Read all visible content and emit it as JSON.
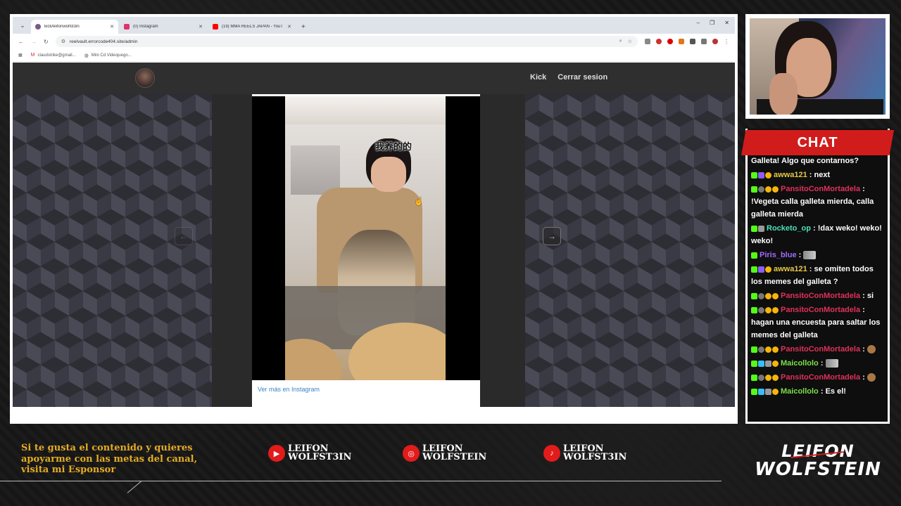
{
  "browser": {
    "tabs": [
      {
        "title": "kick/leifonwolfst3in",
        "active": true,
        "favicon_color": "#7a5a8c"
      },
      {
        "title": "(0) Instagram",
        "active": false,
        "favicon_color": "#e1306c"
      },
      {
        "title": "(19) MMA REELS JAPAN - YouT",
        "active": false,
        "favicon_color": "#ff0000"
      }
    ],
    "url": "reelvault.errorcode404.site/admin",
    "bookmarks": [
      {
        "label": "claudstrike@gmail...",
        "icon": "gmail-icon"
      },
      {
        "label": "Mini Cd Videojuego...",
        "icon": "globe-icon"
      }
    ]
  },
  "site": {
    "nav_links": [
      "Kick",
      "Cerrar sesion"
    ],
    "video_caption": "我养的的",
    "ig_link": "Ver más en Instagram"
  },
  "chat": {
    "title": "CHAT",
    "messages": [
      {
        "user": "",
        "user_color": "#ffffff",
        "badges": [],
        "text": "Galleta! Algo que contarnos?"
      },
      {
        "user": "awwa121",
        "user_color": "#e8c84a",
        "badges": [
          "k",
          "p",
          "o"
        ],
        "text": ": next"
      },
      {
        "user": "PansitoConMortadela",
        "user_color": "#e0305a",
        "badges": [
          "k",
          "g",
          "o",
          "o"
        ],
        "text": ": !Vegeta calla galleta mierda, calla galleta mierda"
      },
      {
        "user": "Rocketo_op",
        "user_color": "#4fe0b8",
        "badges": [
          "k",
          "s"
        ],
        "text": ": !dax weko! weko! weko!"
      },
      {
        "user": "Piris_blue",
        "user_color": "#a06bff",
        "badges": [
          "k"
        ],
        "text": ":",
        "emote": "emote"
      },
      {
        "user": "awwa121",
        "user_color": "#e8c84a",
        "badges": [
          "k",
          "p",
          "o"
        ],
        "text": ": se omiten todos los memes del galleta ?"
      },
      {
        "user": "PansitoConMortadela",
        "user_color": "#e0305a",
        "badges": [
          "k",
          "g",
          "o",
          "o"
        ],
        "text": ": si"
      },
      {
        "user": "PansitoConMortadela",
        "user_color": "#e0305a",
        "badges": [
          "k",
          "g",
          "o",
          "o"
        ],
        "text": ": hagan una encuesta para saltar los memes del galleta"
      },
      {
        "user": "PansitoConMortadela",
        "user_color": "#e0305a",
        "badges": [
          "k",
          "g",
          "o",
          "o"
        ],
        "text": ":",
        "emote": "emote2"
      },
      {
        "user": "Maicollolo",
        "user_color": "#7be04a",
        "badges": [
          "k",
          "b",
          "s",
          "o"
        ],
        "text": ":",
        "emote": "emote"
      },
      {
        "user": "PansitoConMortadela",
        "user_color": "#e0305a",
        "badges": [
          "k",
          "g",
          "o",
          "o"
        ],
        "text": ":",
        "emote": "emote2"
      },
      {
        "user": "Maicollolo",
        "user_color": "#7be04a",
        "badges": [
          "k",
          "b",
          "s",
          "o"
        ],
        "text": ": Es el!"
      }
    ]
  },
  "overlay": {
    "sponsor_text": "Si te gusta el contenido y quieres apoyarme con las metas del canal, visita mi Esponsor",
    "socials": [
      {
        "platform": "youtube",
        "icon": "youtube-icon",
        "name": "LEIFON WOLFST3IN"
      },
      {
        "platform": "instagram",
        "icon": "instagram-icon",
        "name": "LEIFON WOLFSTEIN"
      },
      {
        "platform": "tiktok",
        "icon": "tiktok-icon",
        "name": "LEIFON WOLFST3IN"
      }
    ],
    "brand_line1": "LEIFON",
    "brand_line2": "WOLFSTEIN"
  }
}
